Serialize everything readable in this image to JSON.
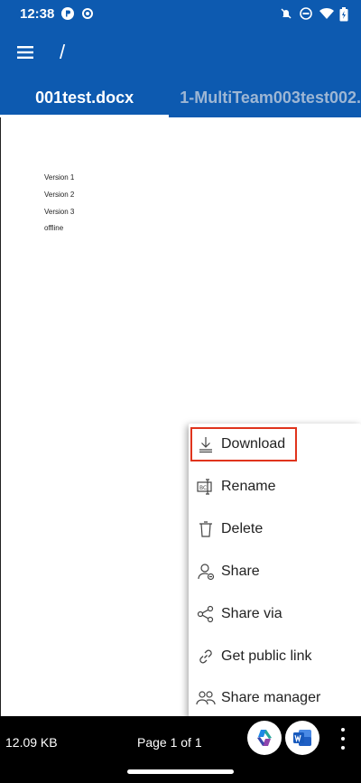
{
  "status": {
    "time": "12:38",
    "icons_left": [
      "app-notification-icon",
      "settings-icon"
    ],
    "icons_right": [
      "mute-icon",
      "dnd-icon",
      "wifi-icon",
      "battery-icon"
    ]
  },
  "appbar": {
    "menu_icon": "hamburger-menu-icon",
    "path": "/"
  },
  "tabs": [
    {
      "label": "001test.docx",
      "active": true
    },
    {
      "label": "1-MultiTeam003test002.",
      "active": false
    }
  ],
  "document": {
    "lines": [
      "Version 1",
      "Version 2",
      "Version 3",
      "offline"
    ]
  },
  "menu": {
    "items": [
      {
        "label": "Download",
        "icon": "download-icon",
        "highlighted": true
      },
      {
        "label": "Rename",
        "icon": "rename-icon"
      },
      {
        "label": "Delete",
        "icon": "delete-icon"
      },
      {
        "label": "Share",
        "icon": "share-person-icon"
      },
      {
        "label": "Share via",
        "icon": "share-via-icon"
      },
      {
        "label": "Get public link",
        "icon": "link-icon"
      },
      {
        "label": "Share manager",
        "icon": "share-manager-icon"
      }
    ]
  },
  "bottombar": {
    "file_size": "12.09 KB",
    "page_info": "Page 1 of 1",
    "copilot_icon": "copilot-icon",
    "word_icon": "word-icon",
    "more_icon": "more-vert-icon"
  },
  "colors": {
    "primary": "#0d5ab0",
    "highlight": "#e0341d"
  }
}
